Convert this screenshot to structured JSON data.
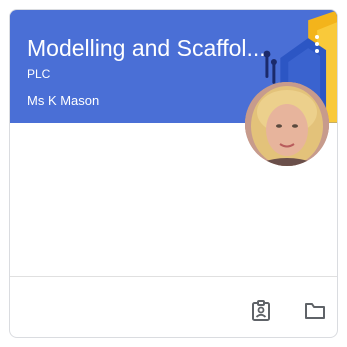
{
  "card": {
    "title": "Modelling and Scaffol...",
    "section": "PLC",
    "teacher": "Ms K Mason"
  },
  "icons": {
    "more": "more-vert-icon",
    "assignment": "assignment-ind-icon",
    "folder": "folder-icon"
  },
  "colors": {
    "banner": "#4a6fd6",
    "text": "#ffffff",
    "icon": "#5f6368"
  }
}
